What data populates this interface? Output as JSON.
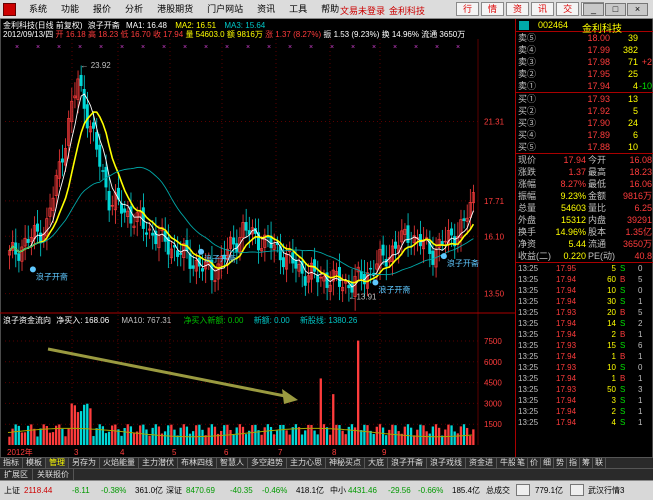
{
  "menu": {
    "items": [
      "系统",
      "功能",
      "报价",
      "分析",
      "港股期货",
      "门户网站",
      "资讯",
      "工具",
      "帮助"
    ],
    "status_text": "文易未登录",
    "stock_tab": "金利科技",
    "quick_tabs": [
      "行",
      "情",
      "资",
      "讯",
      "交",
      "易"
    ],
    "window_buttons": [
      "_",
      "□",
      "×"
    ]
  },
  "header": {
    "line1": [
      "金利科技(日线 前复权)",
      "浪子开斋",
      "MA1: 16.48",
      "MA2: 16.51",
      "MA3: 15.64"
    ],
    "line2": [
      "2012/09/13/四",
      "开 16.18",
      "高 18.23",
      "低 16.70",
      "收 17.94",
      "量 54603.0",
      "额 9816万",
      "涨 1.37 (8.27%)",
      "振 1.53 (9.23%)",
      "换 14.96%",
      "流通 3650万"
    ]
  },
  "price_axis": [
    "21.31",
    "17.71",
    "16.10",
    "13.50"
  ],
  "annotations": {
    "high": "23.92",
    "low": "13.91",
    "signal": "浪子开斋"
  },
  "volume_header": [
    "浪子资金流向",
    "净买入: 168.06",
    "MA10: 767.31",
    "净买入新额: 0.00",
    "新额: 0.00",
    "新股线: 1380.26"
  ],
  "volume_axis": [
    "7500",
    "6000",
    "4500",
    "3000",
    "1500"
  ],
  "date_axis": [
    "2012年",
    "3",
    "4",
    "5",
    "6",
    "7",
    "8",
    "9"
  ],
  "quote": {
    "code": "002464",
    "name": "金利科技",
    "sell": [
      {
        "l": "卖⑤",
        "p": "18.00",
        "v": "39",
        "d": ""
      },
      {
        "l": "卖④",
        "p": "17.99",
        "v": "382",
        "d": ""
      },
      {
        "l": "卖③",
        "p": "17.98",
        "v": "71",
        "d": "+2"
      },
      {
        "l": "卖②",
        "p": "17.95",
        "v": "25",
        "d": ""
      },
      {
        "l": "卖①",
        "p": "17.94",
        "v": "4",
        "d": "-10"
      }
    ],
    "buy": [
      {
        "l": "买①",
        "p": "17.93",
        "v": "13",
        "d": ""
      },
      {
        "l": "买②",
        "p": "17.92",
        "v": "5",
        "d": ""
      },
      {
        "l": "买③",
        "p": "17.90",
        "v": "24",
        "d": ""
      },
      {
        "l": "买④",
        "p": "17.89",
        "v": "6",
        "d": ""
      },
      {
        "l": "买⑤",
        "p": "17.88",
        "v": "10",
        "d": ""
      }
    ],
    "stats": [
      {
        "a": "现价",
        "av": "17.94",
        "b": "今开",
        "bv": "16.08"
      },
      {
        "a": "涨跌",
        "av": "1.37",
        "b": "最高",
        "bv": "18.23"
      },
      {
        "a": "涨幅",
        "av": "8.27%",
        "b": "最低",
        "bv": "16.06"
      },
      {
        "a": "振幅",
        "av": "9.23%",
        "b": "金额",
        "bv": "9816万"
      },
      {
        "a": "总量",
        "av": "54603",
        "b": "量比",
        "bv": "6.25"
      },
      {
        "a": "外盘",
        "av": "15312",
        "b": "内盘",
        "bv": "39291"
      },
      {
        "a": "换手",
        "av": "14.96%",
        "b": "股本",
        "bv": "1.35亿"
      },
      {
        "a": "净资",
        "av": "5.44",
        "b": "流通",
        "bv": "3650万"
      },
      {
        "a": "收益(二)",
        "av": "0.220",
        "b": "PE(动)",
        "bv": "40.8"
      }
    ],
    "ticks": [
      {
        "t": "13:25",
        "p": "17.95",
        "v": "5",
        "s": "S",
        "n": "0"
      },
      {
        "t": "13:25",
        "p": "17.94",
        "v": "60",
        "s": "B",
        "n": "5"
      },
      {
        "t": "13:25",
        "p": "17.94",
        "v": "10",
        "s": "S",
        "n": "0"
      },
      {
        "t": "13:25",
        "p": "17.94",
        "v": "30",
        "s": "S",
        "n": "1"
      },
      {
        "t": "13:25",
        "p": "17.93",
        "v": "20",
        "s": "B",
        "n": "5"
      },
      {
        "t": "13:25",
        "p": "17.94",
        "v": "14",
        "s": "S",
        "n": "2"
      },
      {
        "t": "13:25",
        "p": "17.94",
        "v": "2",
        "s": "B",
        "n": "1"
      },
      {
        "t": "13:25",
        "p": "17.93",
        "v": "15",
        "s": "S",
        "n": "6"
      },
      {
        "t": "13:25",
        "p": "17.94",
        "v": "1",
        "s": "B",
        "n": "1"
      },
      {
        "t": "13:25",
        "p": "17.93",
        "v": "10",
        "s": "S",
        "n": "0"
      },
      {
        "t": "13:25",
        "p": "17.94",
        "v": "1",
        "s": "B",
        "n": "1"
      },
      {
        "t": "13:25",
        "p": "17.93",
        "v": "50",
        "s": "S",
        "n": "3"
      },
      {
        "t": "13:25",
        "p": "17.94",
        "v": "3",
        "s": "S",
        "n": "1"
      },
      {
        "t": "13:25",
        "p": "17.94",
        "v": "2",
        "s": "S",
        "n": "1"
      },
      {
        "t": "13:25",
        "p": "17.94",
        "v": "4",
        "s": "S",
        "n": "1"
      }
    ]
  },
  "tabs": [
    "指标",
    "模板",
    "管理",
    "另存为",
    "火焰能量",
    "主力潜伏",
    "布林四线",
    "智慧人",
    "多空趋势",
    "主力心思",
    "神秘买点",
    "大底",
    "浪子开斋",
    "浪子戏线",
    "资金进",
    "牛股",
    "日线"
  ],
  "right_tabs": [
    "笔",
    "价",
    "细",
    "势",
    "指",
    "筹",
    "联"
  ],
  "tabs2": [
    "扩展区",
    "关联报价"
  ],
  "status": [
    "上证",
    "2118.44",
    "-8.11",
    "-0.38%",
    "361.0亿",
    "深证",
    "8470.69",
    "-40.35",
    "-0.46%",
    "418.1亿",
    "中小",
    "4431.46",
    "-29.56",
    "-0.66%",
    "185.4亿",
    "总成交",
    "779.1亿",
    "武汉行情3"
  ],
  "colors": {
    "up": "#ff3c3c",
    "down": "#00d8d8",
    "ma1": "#ffffff",
    "ma2": "#ffff00",
    "ma3": "#00a8a8",
    "grid": "#5a0000",
    "text_up": "#ff3c3c",
    "text_dn": "#00e000"
  }
}
